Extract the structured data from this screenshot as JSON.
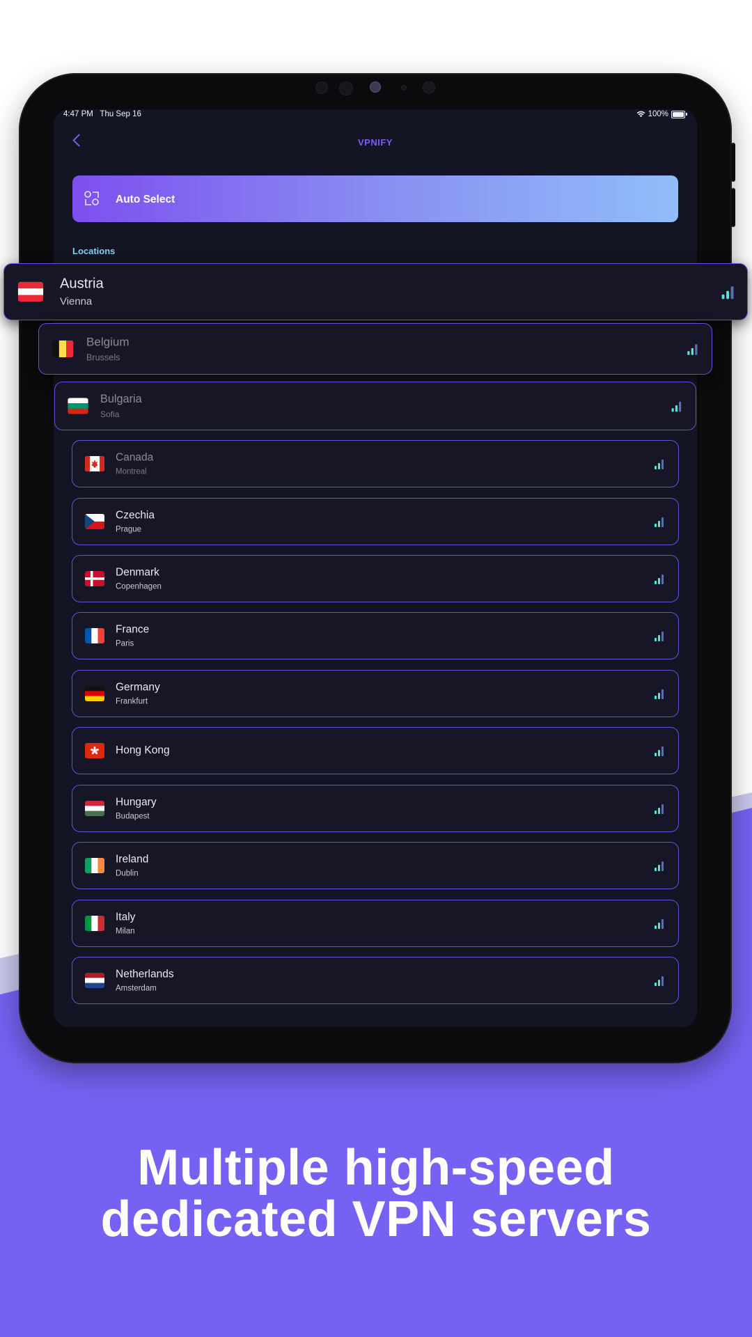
{
  "status_bar": {
    "time": "4:47 PM",
    "date": "Thu Sep 16",
    "battery": "100%"
  },
  "nav": {
    "title": "VPNIFY"
  },
  "auto_select": {
    "label": "Auto Select"
  },
  "section_label": "Locations",
  "locations": [
    {
      "country": "Austria",
      "city": "Vienna",
      "flag": "austria"
    },
    {
      "country": "Belgium",
      "city": "Brussels",
      "flag": "belgium"
    },
    {
      "country": "Bulgaria",
      "city": "Sofia",
      "flag": "bulgaria"
    },
    {
      "country": "Canada",
      "city": "Montreal",
      "flag": "canada"
    },
    {
      "country": "Czechia",
      "city": "Prague",
      "flag": "czechia"
    },
    {
      "country": "Denmark",
      "city": "Copenhagen",
      "flag": "denmark"
    },
    {
      "country": "France",
      "city": "Paris",
      "flag": "france"
    },
    {
      "country": "Germany",
      "city": "Frankfurt",
      "flag": "germany"
    },
    {
      "country": "Hong Kong",
      "city": "",
      "flag": "hongkong"
    },
    {
      "country": "Hungary",
      "city": "Budapest",
      "flag": "hungary"
    },
    {
      "country": "Ireland",
      "city": "Dublin",
      "flag": "ireland"
    },
    {
      "country": "Italy",
      "city": "Milan",
      "flag": "italy"
    },
    {
      "country": "Netherlands",
      "city": "Amsterdam",
      "flag": "netherlands"
    }
  ],
  "headline": {
    "line1": "Multiple high-speed",
    "line2": "dedicated VPN servers"
  },
  "colors": {
    "accent": "#7b5cf0",
    "signal": "#5ce1d8",
    "background_purple": "#7662f2",
    "row_border": "#6552d6"
  }
}
